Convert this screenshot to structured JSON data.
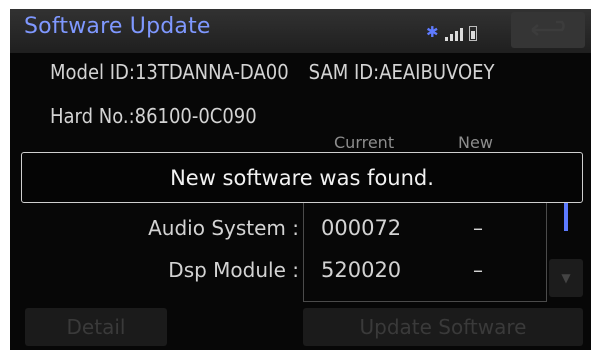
{
  "header": {
    "title": "Software Update",
    "bluetooth_icon": "bluetooth-icon",
    "signal_icon": "signal-icon",
    "battery_icon": "battery-icon",
    "back_icon": "back-arrow-icon"
  },
  "info": {
    "model_id": "Model ID:13TDANNA-DA00",
    "sam_id": "SAM ID:AEAIBUVOEY",
    "hard_no": "Hard No.:86100-0C090"
  },
  "columns": {
    "current": "Current",
    "new": "New"
  },
  "popup": {
    "message": "New software was found."
  },
  "components": [
    {
      "name": "Audio System :",
      "current": "000072",
      "new": "–"
    },
    {
      "name": "Dsp Module :",
      "current": "520020",
      "new": "–"
    }
  ],
  "buttons": {
    "detail": "Detail",
    "update": "Update Software"
  },
  "colors": {
    "accent": "#7f98ff",
    "background": "#070707",
    "text": "#d3d3d3",
    "scroll": "#5c7aff"
  }
}
